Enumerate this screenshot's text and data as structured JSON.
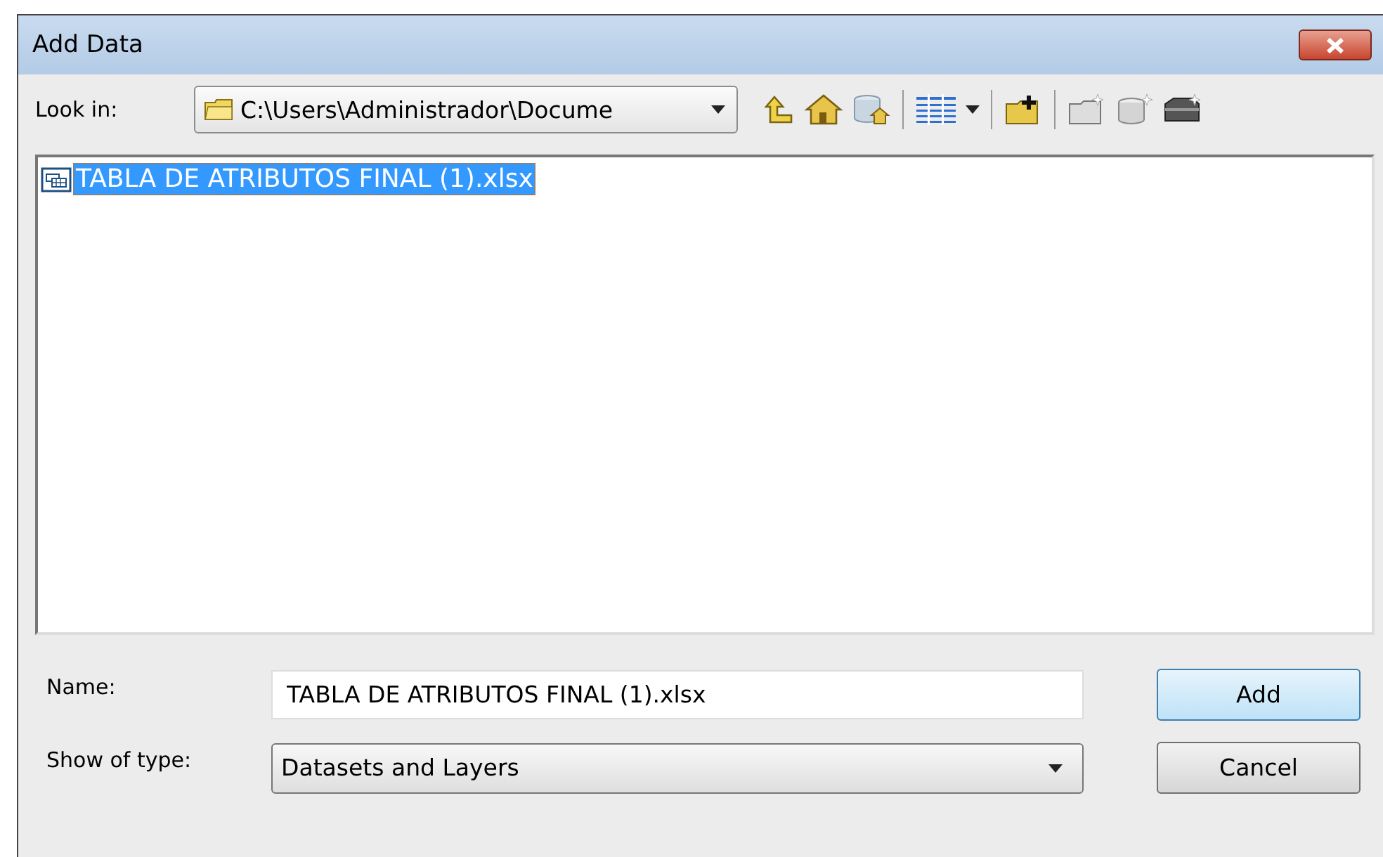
{
  "window": {
    "title": "Add Data"
  },
  "look_in": {
    "label": "Look in:",
    "path": "C:\\Users\\Administrador\\Docume"
  },
  "files": [
    {
      "name": "TABLA DE ATRIBUTOS FINAL (1).xlsx",
      "selected": true
    }
  ],
  "name_field": {
    "label": "Name:",
    "value": "TABLA DE ATRIBUTOS FINAL (1).xlsx"
  },
  "type_field": {
    "label": "Show of type:",
    "value": "Datasets and Layers"
  },
  "buttons": [
    {
      "label": "Add",
      "kind": "default"
    },
    {
      "label": "Cancel",
      "kind": "normal"
    }
  ]
}
